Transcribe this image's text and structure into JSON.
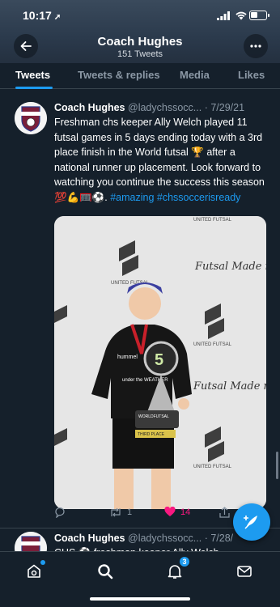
{
  "status": {
    "time": "10:17"
  },
  "header": {
    "title": "Coach Hughes",
    "subtitle": "151 Tweets"
  },
  "tabs": [
    {
      "label": "Tweets",
      "active": true
    },
    {
      "label": "Tweets & replies",
      "active": false
    },
    {
      "label": "Media",
      "active": false
    },
    {
      "label": "Likes",
      "active": false
    }
  ],
  "tweet": {
    "name": "Coach Hughes",
    "handle": "@ladychssocc...",
    "date": "· 7/29/21",
    "text": "Freshman chs keeper Ally Welch played 11 futsal games in 5 days ending today with a 3rd place finish in the World futsal 🏆 after a national runner up placement.  Look forward to watching you continue the success this season 💯💪🥅⚽.",
    "hashtag1": "#amazing",
    "hashtag2": "#chssoccerisready",
    "avatar_text": "LADY COUGARS SOCCER",
    "media": {
      "banner_brand": "UNITED FUTSAL",
      "script_text": "Futsal Made me.",
      "jersey": "hummel",
      "shirt_text": "under the WEATHER",
      "trophy_logo": "WORLDFUTSAL",
      "trophy_place": "THIRD PLACE"
    },
    "reply_count": "",
    "retweet_count": "1",
    "like_count": "14"
  },
  "tweet2": {
    "name": "Coach Hughes",
    "handle": "@ladychssocc...",
    "date": "· 7/28/",
    "text": "CHS ⚽ freshman keeper Ally Welch"
  },
  "nav": {
    "notifications_badge": "3"
  },
  "colors": {
    "accent": "#1d9bf0",
    "background": "#15202b",
    "like": "#f91880"
  }
}
